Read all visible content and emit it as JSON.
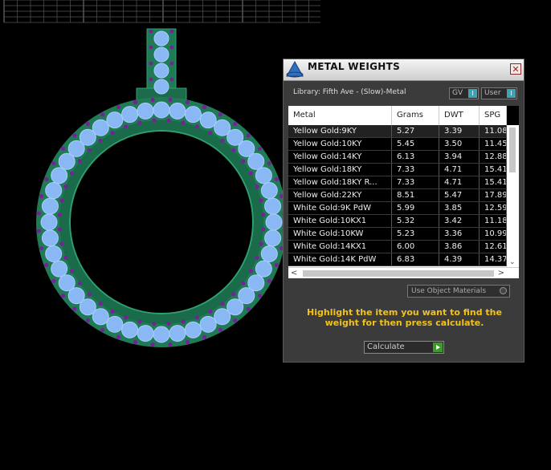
{
  "panel": {
    "title": "METAL WEIGHTS",
    "close_glyph": "✕",
    "library_text": "Library: Fifth Ave - (Slow)-Metal",
    "gv_label": "GV",
    "user_label": "User",
    "toggle_glyph": "I",
    "columns": [
      "Metal",
      "Grams",
      "DWT",
      "SPG"
    ],
    "rows": [
      [
        "Yellow Gold:9KY",
        "5.27",
        "3.39",
        "11.08"
      ],
      [
        "Yellow Gold:10KY",
        "5.45",
        "3.50",
        "11.45"
      ],
      [
        "Yellow Gold:14KY",
        "6.13",
        "3.94",
        "12.88"
      ],
      [
        "Yellow Gold:18KY",
        "7.33",
        "4.71",
        "15.41"
      ],
      [
        "Yellow Gold:18KY R...",
        "7.33",
        "4.71",
        "15.41"
      ],
      [
        "Yellow Gold:22KY",
        "8.51",
        "5.47",
        "17.89"
      ],
      [
        "White Gold:9K PdW",
        "5.99",
        "3.85",
        "12.59"
      ],
      [
        "White Gold:10KX1",
        "5.32",
        "3.42",
        "11.18"
      ],
      [
        "White Gold:10KW",
        "5.23",
        "3.36",
        "10.99"
      ],
      [
        "White Gold:14KX1",
        "6.00",
        "3.86",
        "12.61"
      ],
      [
        "White Gold:14K PdW",
        "6.83",
        "4.39",
        "14.37"
      ]
    ],
    "scroll_down_glyph": "⌄",
    "scroll_left_glyph": "<",
    "scroll_right_glyph": ">",
    "use_object_materials": "Use Object Materials",
    "instruction": "Highlight the item you want to find the weight for then press calculate.",
    "calculate_label": "Calculate",
    "colors": {
      "accent_yellow": "#f2c21b",
      "toggle_teal": "#3aa6b4",
      "calc_green": "#3d9a2a"
    }
  },
  "viewport": {
    "object": "ring-pendant",
    "colors": {
      "metal": "#1f7a55",
      "stone": "#8ab8f5",
      "prong": "#7a1f9c"
    }
  }
}
